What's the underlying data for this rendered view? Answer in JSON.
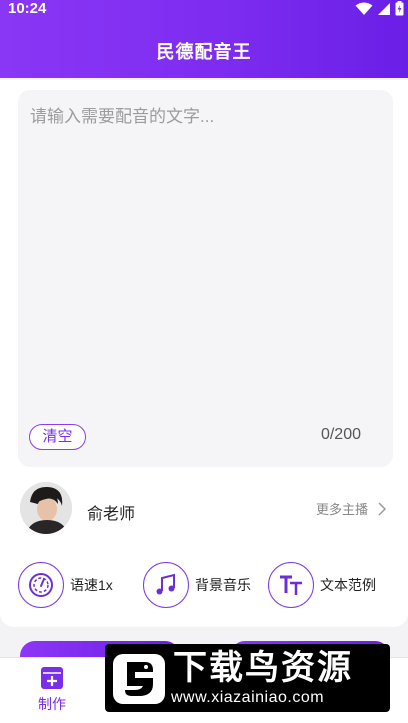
{
  "status_bar": {
    "time": "10:24"
  },
  "header": {
    "title": "民德配音王"
  },
  "editor": {
    "placeholder": "请输入需要配音的文字...",
    "value": "",
    "clear_label": "清空",
    "char_count": "0/200"
  },
  "voice": {
    "name": "俞老师",
    "more_label": "更多主播"
  },
  "options": [
    {
      "label": "语速1x",
      "icon": "speed-gauge-icon"
    },
    {
      "label": "背景音乐",
      "icon": "music-note-icon"
    },
    {
      "label": "文本范例",
      "icon": "text-sample-icon"
    }
  ],
  "tabbar": {
    "tabs": [
      {
        "label": "制作",
        "icon": "create-plus-icon",
        "active": true
      }
    ]
  },
  "watermark": {
    "title": "下载鸟资源",
    "url": "www.xiazainiao.com"
  },
  "colors": {
    "accent": "#7a2ee8",
    "header_start": "#8a36f5",
    "header_end": "#6a1fe6"
  }
}
